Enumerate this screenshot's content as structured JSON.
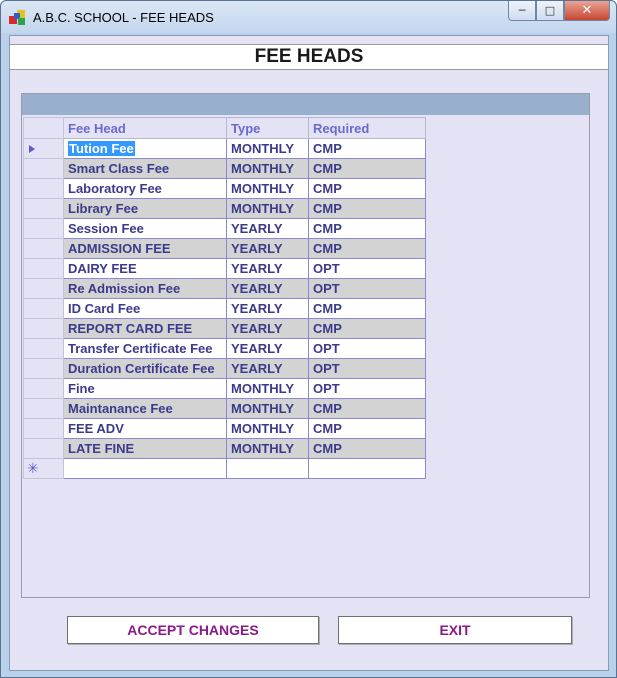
{
  "window": {
    "title": "A.B.C. SCHOOL - FEE HEADS",
    "controls": {
      "minimize": "─",
      "maximize": "□",
      "close": "✕"
    }
  },
  "page": {
    "title": "FEE HEADS"
  },
  "grid": {
    "columns": [
      "Fee Head",
      "Type",
      "Required"
    ],
    "rows": [
      {
        "fee_head": "Tution Fee",
        "type": "MONTHLY",
        "required": "CMP"
      },
      {
        "fee_head": "Smart Class Fee",
        "type": "MONTHLY",
        "required": "CMP"
      },
      {
        "fee_head": "Laboratory Fee",
        "type": "MONTHLY",
        "required": "CMP"
      },
      {
        "fee_head": "Library Fee",
        "type": "MONTHLY",
        "required": "CMP"
      },
      {
        "fee_head": "Session Fee",
        "type": "YEARLY",
        "required": "CMP"
      },
      {
        "fee_head": "ADMISSION FEE",
        "type": "YEARLY",
        "required": "CMP"
      },
      {
        "fee_head": "DAIRY FEE",
        "type": "YEARLY",
        "required": "OPT"
      },
      {
        "fee_head": "Re Admission Fee",
        "type": "YEARLY",
        "required": "OPT"
      },
      {
        "fee_head": "ID Card Fee",
        "type": "YEARLY",
        "required": "CMP"
      },
      {
        "fee_head": "REPORT CARD FEE",
        "type": "YEARLY",
        "required": "CMP"
      },
      {
        "fee_head": "Transfer Certificate Fee",
        "type": "YEARLY",
        "required": "OPT"
      },
      {
        "fee_head": "Duration Certificate Fee",
        "type": "YEARLY",
        "required": "OPT"
      },
      {
        "fee_head": "Fine",
        "type": "MONTHLY",
        "required": "OPT"
      },
      {
        "fee_head": "Maintanance Fee",
        "type": "MONTHLY",
        "required": "CMP"
      },
      {
        "fee_head": "FEE ADV",
        "type": "MONTHLY",
        "required": "CMP"
      },
      {
        "fee_head": "LATE FINE",
        "type": "MONTHLY",
        "required": "CMP"
      }
    ],
    "current_row_icon": "row-indicator-arrow-icon",
    "new_row_icon": "new-row-asterisk-icon",
    "new_row_symbol": "✳"
  },
  "buttons": {
    "accept": "ACCEPT CHANGES",
    "exit": "EXIT"
  },
  "colors": {
    "window_frame": "#b9d1ea",
    "client_bg": "#e3e3f5",
    "grid_caption": "#98b0cd",
    "cell_text": "#3b3b8c",
    "header_text": "#6a6ad0",
    "button_text": "#8a1a8a",
    "selection": "#3399ff"
  }
}
